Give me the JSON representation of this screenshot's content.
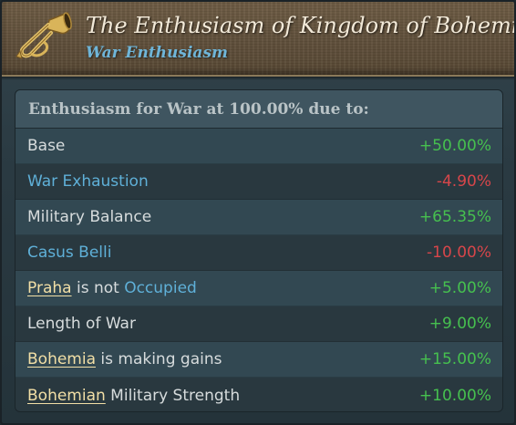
{
  "header": {
    "icon": "bugle-icon",
    "title": "The Enthusiasm of Kingdom of Bohemia",
    "subtitle": "War Enthusiasm"
  },
  "panel": {
    "heading": "Enthusiasm for War at 100.00% due to:",
    "rows": [
      {
        "label": "Base",
        "value": "+50.00%"
      },
      {
        "label": "War Exhaustion",
        "value": "-4.90%"
      },
      {
        "label": "Military Balance",
        "value": "+65.35%"
      },
      {
        "label": "Casus Belli",
        "value": "-10.00%"
      },
      {
        "place": "Praha",
        "mid": " is not ",
        "status": "Occupied",
        "value": "+5.00%"
      },
      {
        "label": "Length of War",
        "value": "+9.00%"
      },
      {
        "place": "Bohemia",
        "rest": " is making gains",
        "value": "+15.00%"
      },
      {
        "place": "Bohemian",
        "rest": " Military Strength",
        "value": "+10.00%"
      }
    ]
  },
  "colors": {
    "positive": "#46c04f",
    "negative": "#d7464a",
    "link": "#5fb0d8",
    "location": "#f2dfa6",
    "header_bg": "#5e4e39"
  }
}
